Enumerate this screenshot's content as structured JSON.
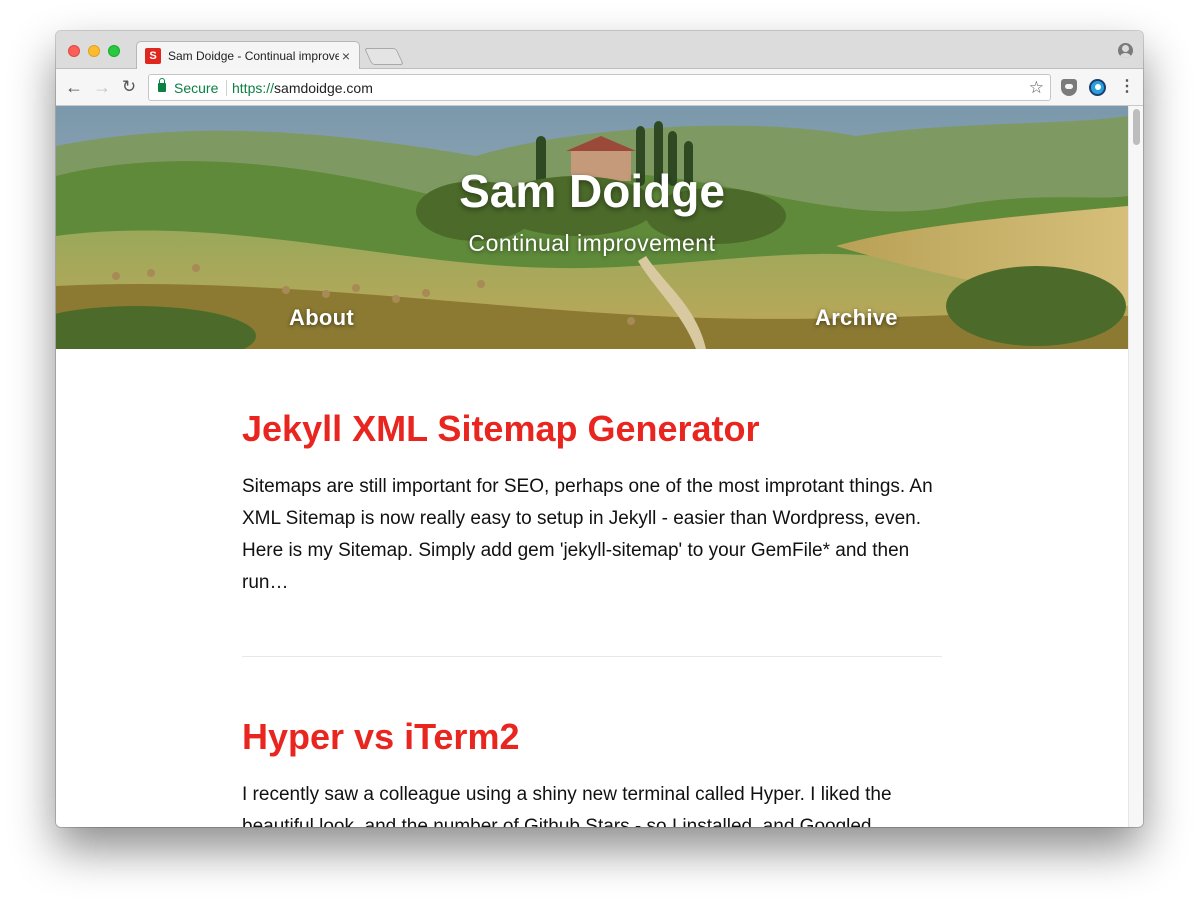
{
  "browser": {
    "tab": {
      "favicon_letter": "S",
      "title": "Sam Doidge - Continual improvement",
      "close_glyph": "×"
    },
    "toolbar": {
      "back_glyph": "←",
      "forward_glyph": "→",
      "reload_glyph": "↻",
      "secure_label": "Secure",
      "url_scheme": "https://",
      "url_host": "samdoidge.com",
      "bookmark_glyph": "☆",
      "menu_glyph": "⋮"
    },
    "icons": [
      "profile-icon",
      "lock-icon",
      "star-icon",
      "extension-icon",
      "extension-icon",
      "menu-icon"
    ]
  },
  "header": {
    "title": "Sam Doidge",
    "subtitle": "Continual improvement",
    "nav": [
      {
        "label": "About"
      },
      {
        "label": "Archive"
      }
    ]
  },
  "posts": [
    {
      "title": "Jekyll XML Sitemap Generator",
      "excerpt": "Sitemaps are still important for SEO, perhaps one of the most improtant things. An XML Sitemap is now really easy to setup in Jekyll - easier than Wordpress, even. Here is my Sitemap. Simply add gem 'jekyll-sitemap' to your GemFile* and then run…"
    },
    {
      "title": "Hyper vs iTerm2",
      "excerpt": "I recently saw a colleague using a shiny new terminal called Hyper. I liked the beautiful look, and the number of Github Stars - so I installed, and Googled…"
    }
  ],
  "colors": {
    "accent": "#e8261f",
    "secure": "#0b8043"
  }
}
